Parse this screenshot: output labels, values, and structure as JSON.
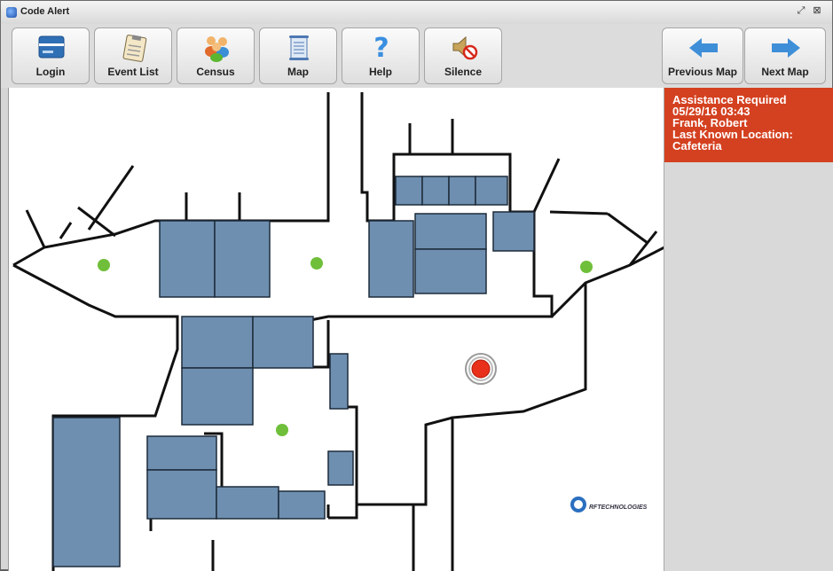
{
  "window": {
    "title": "Code Alert"
  },
  "toolbar": {
    "login_label": "Login",
    "event_list_label": "Event List",
    "census_label": "Census",
    "map_label": "Map",
    "help_label": "Help",
    "silence_label": "Silence",
    "previous_map_label": "Previous Map",
    "next_map_label": "Next Map"
  },
  "alert": {
    "line1": "Assistance Required",
    "line2": "05/29/16 03:43",
    "line3": "Frank, Robert",
    "line4": "Last Known Location:",
    "line5": "Cafeteria",
    "color": "#d44120"
  },
  "map": {
    "logo_text": "RFTECHNOLOGIES",
    "room_color": "#6f8fb0",
    "alarm_color": "#e8301a",
    "marker_color": "#6fbf3a"
  }
}
